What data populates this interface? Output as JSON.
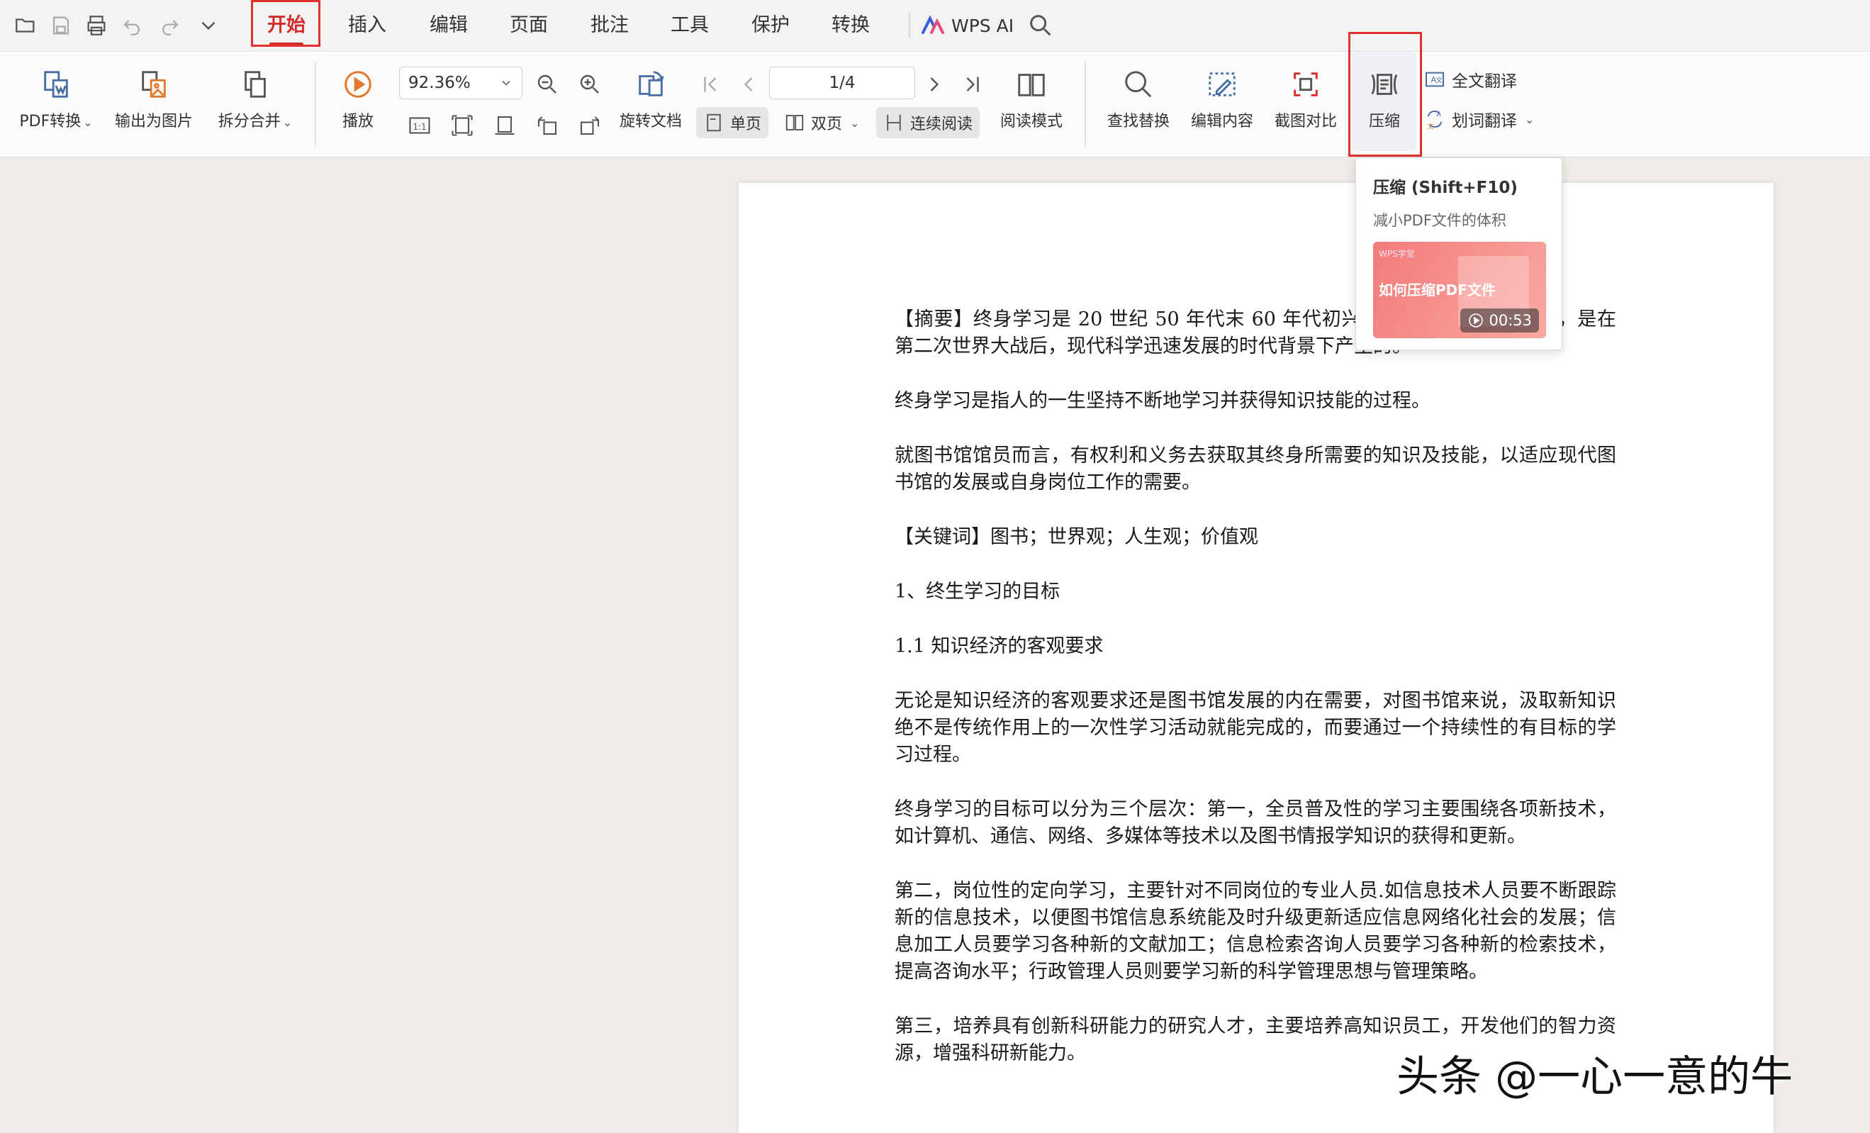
{
  "menu": {
    "tabs": [
      "开始",
      "插入",
      "编辑",
      "页面",
      "批注",
      "工具",
      "保护",
      "转换"
    ],
    "ai_label": "WPS AI"
  },
  "ribbon": {
    "pdf_convert": "PDF转换",
    "export_image": "输出为图片",
    "split_merge": "拆分合并",
    "play": "播放",
    "zoom": "92.36%",
    "page_indicator": "1/4",
    "rotate_doc": "旋转文档",
    "single_page": "单页",
    "double_page": "双页",
    "continuous": "连续阅读",
    "read_mode": "阅读模式",
    "find_replace": "查找替换",
    "edit_content": "编辑内容",
    "screenshot_compare": "截图对比",
    "compress": "压缩",
    "full_translate": "全文翻译",
    "word_translate": "划词翻译"
  },
  "tooltip": {
    "title": "压缩 (Shift+F10)",
    "desc": "减小PDF文件的体积",
    "video_label": "WPS学堂",
    "video_title": "如何压缩PDF文件",
    "duration": "00:53"
  },
  "document": {
    "paragraphs": [
      "【摘要】终身学习是 20 世纪 50 年代末 60 年代初兴起的一种国际教育思潮，是在第二次世界大战后，现代科学迅速发展的时代背景下产生的。",
      "终身学习是指人的一生坚持不断地学习并获得知识技能的过程。",
      "就图书馆馆员而言，有权利和义务去获取其终身所需要的知识及技能，以适应现代图书馆的发展或自身岗位工作的需要。",
      "【关键词】图书；世界观；人生观；价值观",
      "1、终生学习的目标",
      "1.1 知识经济的客观要求",
      "无论是知识经济的客观要求还是图书馆发展的内在需要，对图书馆来说，汲取新知识绝不是传统作用上的一次性学习活动就能完成的，而要通过一个持续性的有目标的学习过程。",
      "终身学习的目标可以分为三个层次：第一，全员普及性的学习主要围绕各项新技术，如计算机、通信、网络、多媒体等技术以及图书情报学知识的获得和更新。",
      "第二，岗位性的定向学习，主要针对不同岗位的专业人员.如信息技术人员要不断跟踪新的信息技术，以便图书馆信息系统能及时升级更新适应信息网络化社会的发展；信息加工人员要学习各种新的文献加工；信息检索咨询人员要学习各种新的检索技术，提高咨询水平；行政管理人员则要学习新的科学管理思想与管理策略。",
      "第三，培养具有创新科研能力的研究人才，主要培养高知识员工，开发他们的智力资源，增强科研新能力。"
    ]
  },
  "watermark": "头条 @一心一意的牛",
  "colors": {
    "accent": "#d42b2b",
    "highlight_box": "#e0312f"
  }
}
